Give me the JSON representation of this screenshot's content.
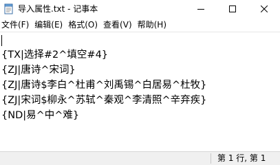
{
  "window": {
    "title": "导入属性.txt - 记事本"
  },
  "title_icons": {
    "app": "notepad-icon",
    "minimize": "minimize-icon",
    "maximize": "maximize-icon",
    "close": "close-icon"
  },
  "menu": {
    "file": "文件(F)",
    "edit": "编辑(E)",
    "format": "格式(O)",
    "view": "查看(V)",
    "help": "帮助(H)"
  },
  "editor": {
    "lines": [
      "",
      "{TX|选择#2^填空#4}",
      "{ZJ|唐诗^宋词}",
      "{ZJ|唐诗$李白^杜甫^刘禹锡^白居易^杜牧}",
      "{ZJ|宋词$柳永^苏轼^秦观^李清照^辛弃疾}",
      "{ND|易^中^难}"
    ]
  },
  "status": {
    "position": "第 1 行, 第 1"
  }
}
